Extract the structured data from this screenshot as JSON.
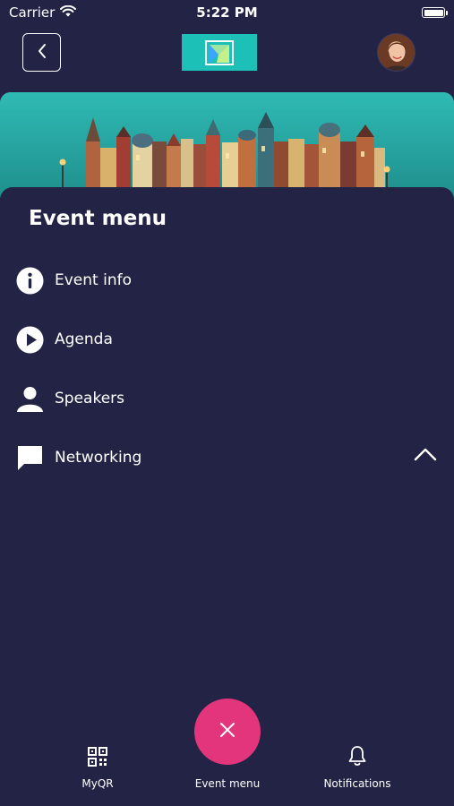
{
  "status_bar": {
    "carrier": "Carrier",
    "time": "5:22 PM"
  },
  "header": {
    "back_icon": "chevron-left-icon",
    "logo_icon": "app-logo",
    "avatar_icon": "user-avatar"
  },
  "banner": {
    "image": "city-of-books-illustration"
  },
  "panel": {
    "title": "Event menu",
    "items": [
      {
        "label": "Event info",
        "icon": "info-icon"
      },
      {
        "label": "Agenda",
        "icon": "play-icon"
      },
      {
        "label": "Speakers",
        "icon": "person-icon"
      },
      {
        "label": "Networking",
        "icon": "chat-icon",
        "expanded": true
      }
    ]
  },
  "tabbar": {
    "tabs": [
      {
        "label": "MyQR",
        "icon": "qr-code-icon"
      },
      {
        "label": "Event menu",
        "icon": "close-icon"
      },
      {
        "label": "Notifications",
        "icon": "bell-icon"
      }
    ]
  },
  "colors": {
    "background": "#232445",
    "accent": "#e2357c",
    "logo": "#1cc0b6"
  }
}
